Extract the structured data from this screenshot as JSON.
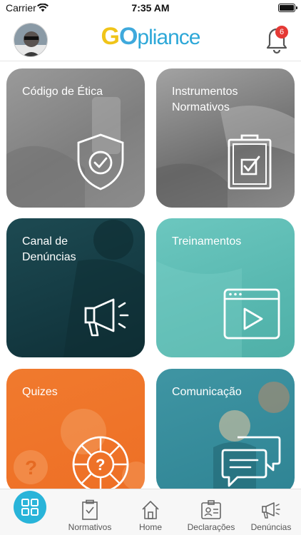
{
  "status_bar": {
    "carrier": "Carrier",
    "time": "7:35 AM"
  },
  "header": {
    "logo_part1": "G",
    "logo_part2": "O",
    "logo_part3": "pliance",
    "notification_count": "6"
  },
  "tiles": [
    {
      "label": "Código de Ética",
      "icon": "shield-check-icon"
    },
    {
      "label": "Instrumentos Normativos",
      "icon": "clipboard-check-icon"
    },
    {
      "label": "Canal de Denúncias",
      "icon": "megaphone-icon"
    },
    {
      "label": "Treinamentos",
      "icon": "video-play-icon"
    },
    {
      "label": "Quizes",
      "icon": "quiz-wheel-icon"
    },
    {
      "label": "Comunicação",
      "icon": "chat-bubbles-icon"
    }
  ],
  "tabbar": {
    "items": [
      {
        "label": "",
        "icon": "grid-icon"
      },
      {
        "label": "Normativos",
        "icon": "clipboard-icon"
      },
      {
        "label": "Home",
        "icon": "home-icon"
      },
      {
        "label": "Declarações",
        "icon": "id-card-icon"
      },
      {
        "label": "Denúncias",
        "icon": "megaphone-icon"
      }
    ]
  },
  "colors": {
    "accent": "#29b4d9",
    "logo_yellow": "#f0c419",
    "logo_blue": "#2ea8d8",
    "badge": "#e53935"
  }
}
